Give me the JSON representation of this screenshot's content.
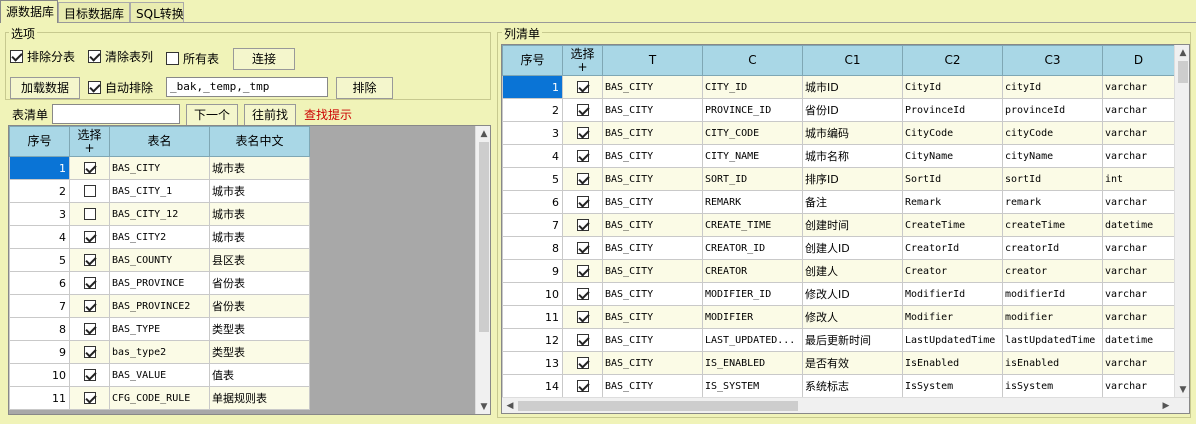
{
  "tabs": [
    "源数据库",
    "目标数据库",
    "SQL转换"
  ],
  "options": {
    "title": "选项",
    "exclude_table": {
      "label": "排除分表",
      "checked": true
    },
    "clear_columns": {
      "label": "清除表列",
      "checked": true
    },
    "all_tables": {
      "label": "所有表",
      "checked": false
    },
    "connect_button": "连接",
    "load_button": "加载数据",
    "auto_exclude": {
      "label": "自动排除",
      "checked": true
    },
    "exclude_pattern": "_bak,_temp,_tmp",
    "exclude_button": "排除"
  },
  "table_search": {
    "label": "表清单",
    "value": "",
    "next_button": "下一个",
    "prev_button": "往前找",
    "hint": "查找提示"
  },
  "table_list": {
    "headers": [
      "序号",
      "选择\n+",
      "表名",
      "表名中文"
    ],
    "rows": [
      {
        "no": "1",
        "checked": true,
        "name": "BAS_CITY",
        "cn": "城市表"
      },
      {
        "no": "2",
        "checked": false,
        "name": "BAS_CITY_1",
        "cn": "城市表"
      },
      {
        "no": "3",
        "checked": false,
        "name": "BAS_CITY_12",
        "cn": "城市表"
      },
      {
        "no": "4",
        "checked": true,
        "name": "BAS_CITY2",
        "cn": "城市表"
      },
      {
        "no": "5",
        "checked": true,
        "name": "BAS_COUNTY",
        "cn": "县区表"
      },
      {
        "no": "6",
        "checked": true,
        "name": "BAS_PROVINCE",
        "cn": "省份表"
      },
      {
        "no": "7",
        "checked": true,
        "name": "BAS_PROVINCE2",
        "cn": "省份表"
      },
      {
        "no": "8",
        "checked": true,
        "name": "BAS_TYPE",
        "cn": "类型表"
      },
      {
        "no": "9",
        "checked": true,
        "name": "bas_type2",
        "cn": "类型表"
      },
      {
        "no": "10",
        "checked": true,
        "name": "BAS_VALUE",
        "cn": "值表"
      },
      {
        "no": "11",
        "checked": true,
        "name": "CFG_CODE_RULE",
        "cn": "单据规则表"
      }
    ]
  },
  "column_list": {
    "title": "列清单",
    "headers": [
      "序号",
      "选择\n+",
      "T",
      "C",
      "C1",
      "C2",
      "C3",
      "D"
    ],
    "rows": [
      {
        "no": "1",
        "checked": true,
        "t": "BAS_CITY",
        "c": "CITY_ID",
        "c1": "城市ID",
        "c2": "CityId",
        "c3": "cityId",
        "d": "varchar"
      },
      {
        "no": "2",
        "checked": true,
        "t": "BAS_CITY",
        "c": "PROVINCE_ID",
        "c1": "省份ID",
        "c2": "ProvinceId",
        "c3": "provinceId",
        "d": "varchar"
      },
      {
        "no": "3",
        "checked": true,
        "t": "BAS_CITY",
        "c": "CITY_CODE",
        "c1": "城市编码",
        "c2": "CityCode",
        "c3": "cityCode",
        "d": "varchar"
      },
      {
        "no": "4",
        "checked": true,
        "t": "BAS_CITY",
        "c": "CITY_NAME",
        "c1": "城市名称",
        "c2": "CityName",
        "c3": "cityName",
        "d": "varchar"
      },
      {
        "no": "5",
        "checked": true,
        "t": "BAS_CITY",
        "c": "SORT_ID",
        "c1": "排序ID",
        "c2": "SortId",
        "c3": "sortId",
        "d": "int"
      },
      {
        "no": "6",
        "checked": true,
        "t": "BAS_CITY",
        "c": "REMARK",
        "c1": "备注",
        "c2": "Remark",
        "c3": "remark",
        "d": "varchar"
      },
      {
        "no": "7",
        "checked": true,
        "t": "BAS_CITY",
        "c": "CREATE_TIME",
        "c1": "创建时间",
        "c2": "CreateTime",
        "c3": "createTime",
        "d": "datetime"
      },
      {
        "no": "8",
        "checked": true,
        "t": "BAS_CITY",
        "c": "CREATOR_ID",
        "c1": "创建人ID",
        "c2": "CreatorId",
        "c3": "creatorId",
        "d": "varchar"
      },
      {
        "no": "9",
        "checked": true,
        "t": "BAS_CITY",
        "c": "CREATOR",
        "c1": "创建人",
        "c2": "Creator",
        "c3": "creator",
        "d": "varchar"
      },
      {
        "no": "10",
        "checked": true,
        "t": "BAS_CITY",
        "c": "MODIFIER_ID",
        "c1": "修改人ID",
        "c2": "ModifierId",
        "c3": "modifierId",
        "d": "varchar"
      },
      {
        "no": "11",
        "checked": true,
        "t": "BAS_CITY",
        "c": "MODIFIER",
        "c1": "修改人",
        "c2": "Modifier",
        "c3": "modifier",
        "d": "varchar"
      },
      {
        "no": "12",
        "checked": true,
        "t": "BAS_CITY",
        "c": "LAST_UPDATED...",
        "c1": "最后更新时间",
        "c2": "LastUpdatedTime",
        "c3": "lastUpdatedTime",
        "d": "datetime"
      },
      {
        "no": "13",
        "checked": true,
        "t": "BAS_CITY",
        "c": "IS_ENABLED",
        "c1": "是否有效",
        "c2": "IsEnabled",
        "c3": "isEnabled",
        "d": "varchar"
      },
      {
        "no": "14",
        "checked": true,
        "t": "BAS_CITY",
        "c": "IS_SYSTEM",
        "c1": "系统标志",
        "c2": "IsSystem",
        "c3": "isSystem",
        "d": "varchar"
      }
    ]
  },
  "colors": {
    "background": "#f0f3b8",
    "header": "#a9d7e6",
    "selection": "#0a74d6",
    "hint": "#cc0000"
  }
}
